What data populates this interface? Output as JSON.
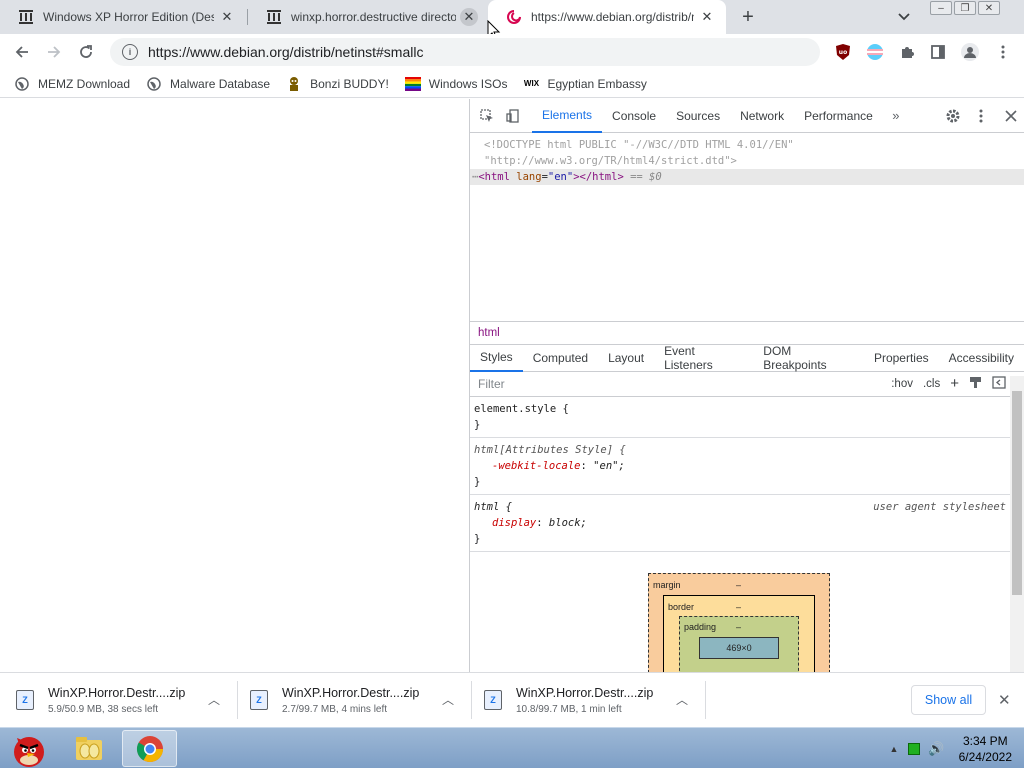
{
  "tabs": [
    {
      "title": "Windows XP Horror Edition (Destructive",
      "favicon": "archive-icon"
    },
    {
      "title": "winxp.horror.destructive directory",
      "favicon": "archive-icon"
    },
    {
      "title": "https://www.debian.org/distrib/netinst#smallcd",
      "favicon": "debian-swirl-icon"
    }
  ],
  "toolbar": {
    "url": "https://www.debian.org/distrib/netinst#smallc"
  },
  "bookmarks": [
    {
      "label": "MEMZ Download",
      "icon": "globe-icon"
    },
    {
      "label": "Malware Database",
      "icon": "globe-icon"
    },
    {
      "label": "Bonzi BUDDY!",
      "icon": "bonzi-icon"
    },
    {
      "label": "Windows ISOs",
      "icon": "rainbow-flag-icon"
    },
    {
      "label": "Egyptian Embassy",
      "icon": "wix-icon"
    }
  ],
  "devtools": {
    "tabs": [
      "Elements",
      "Console",
      "Sources",
      "Network",
      "Performance"
    ],
    "active_tab": "Elements",
    "dom": {
      "doctype_line1": "<!DOCTYPE html PUBLIC \"-//W3C//DTD HTML 4.01//EN\"",
      "doctype_line2": "\"http://www.w3.org/TR/html4/strict.dtd\">",
      "html_open": "<html",
      "attr_name": "lang",
      "attr_value": "\"en\"",
      "html_close": "></html>",
      "selected_marker": "== $0"
    },
    "breadcrumb": "html",
    "subtabs": [
      "Styles",
      "Computed",
      "Layout",
      "Event Listeners",
      "DOM Breakpoints",
      "Properties",
      "Accessibility"
    ],
    "filter_placeholder": "Filter",
    "hov": ":hov",
    "cls": ".cls",
    "rules": {
      "r1_selector": "element.style {",
      "r1_close": "}",
      "r2_selector": "html[Attributes Style] {",
      "r2_prop": "-webkit-locale",
      "r2_val": "\"en\";",
      "r2_close": "}",
      "r3_selector": "html {",
      "r3_source": "user agent stylesheet",
      "r3_prop": "display",
      "r3_val": "block;",
      "r3_close": "}"
    },
    "boxmodel": {
      "margin_label": "margin",
      "border_label": "border",
      "padding_label": "padding",
      "dash": "–",
      "content": "469×0"
    }
  },
  "downloads": [
    {
      "name": "WinXP.Horror.Destr....zip",
      "status": "5.9/50.9 MB, 38 secs left"
    },
    {
      "name": "WinXP.Horror.Destr....zip",
      "status": "2.7/99.7 MB, 4 mins left"
    },
    {
      "name": "WinXP.Horror.Destr....zip",
      "status": "10.8/99.7 MB, 1 min left"
    }
  ],
  "show_all": "Show all",
  "clock": {
    "time": "3:34 PM",
    "date": "6/24/2022"
  },
  "colors": {
    "accent": "#1a73e8",
    "taskbar": "#8fabcf"
  }
}
